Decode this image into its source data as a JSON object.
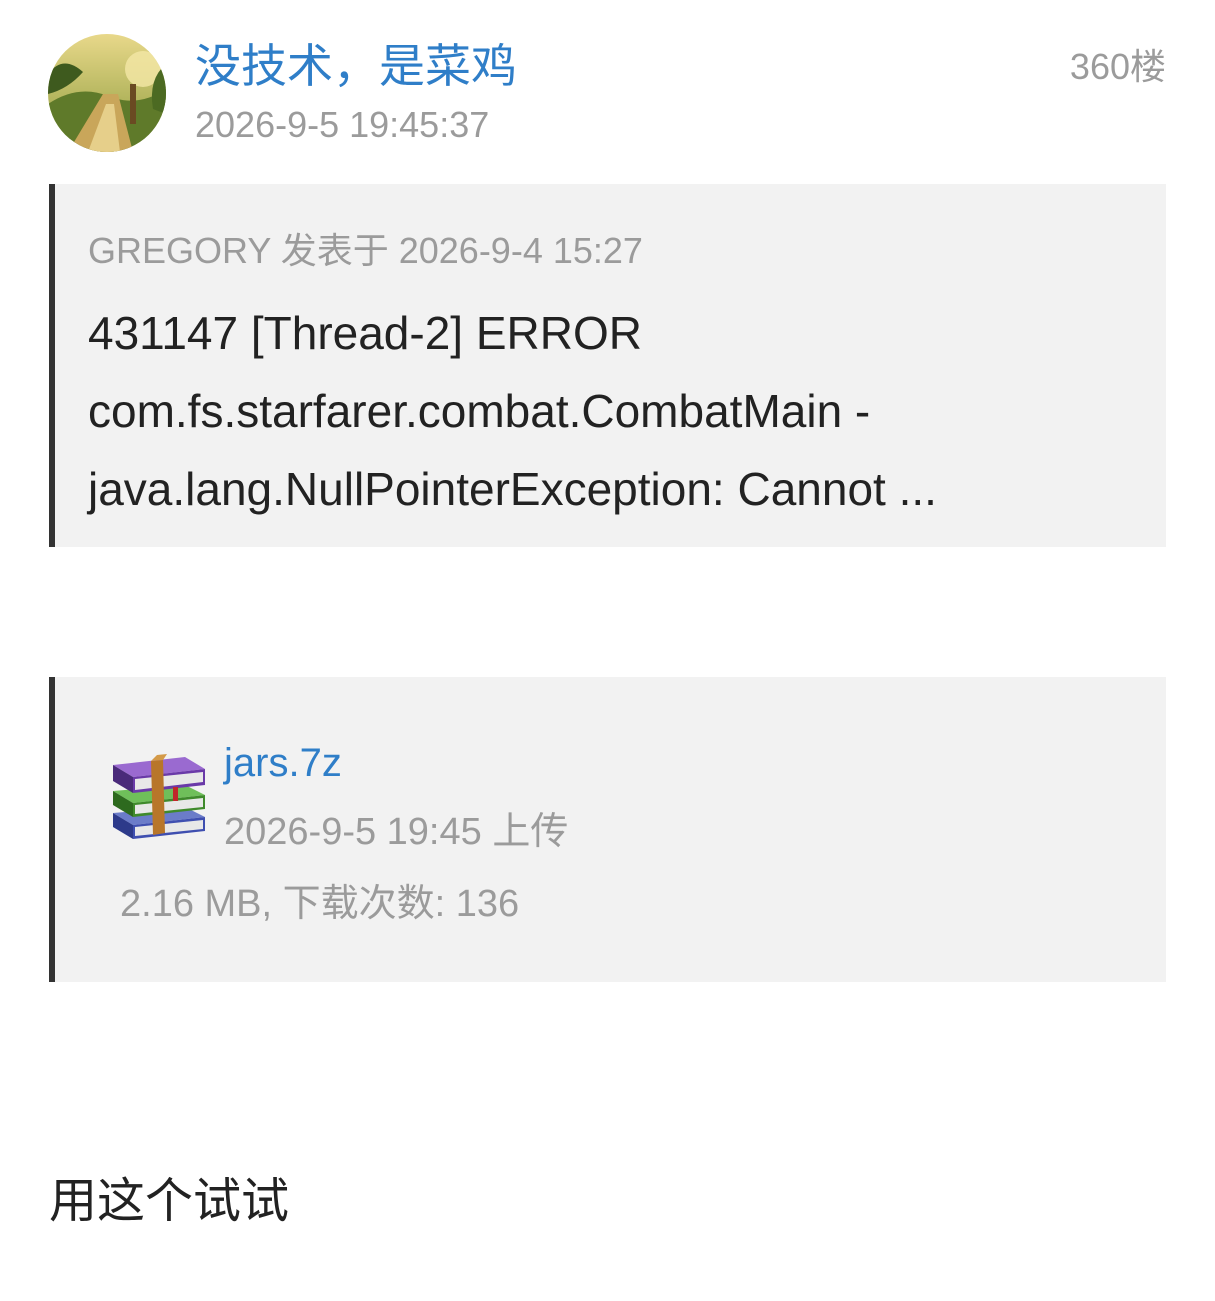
{
  "post": {
    "avatar_icon": "user-avatar-image",
    "username": "没技术，是菜鸡",
    "timestamp": "2026-9-5 19:45:37",
    "floor": "360楼"
  },
  "quote": {
    "meta": "GREGORY 发表于 2026-9-4 15:27",
    "lines": [
      "431147 [Thread-2] ERROR",
      "com.fs.starfarer.combat.CombatMain  -",
      "java.lang.NullPointerException: Cannot ..."
    ]
  },
  "attachment": {
    "icon": "archive-icon",
    "file_name": "jars.7z",
    "upload_time": "2026-9-5 19:45 上传",
    "info": "2.16 MB, 下载次数: 136"
  },
  "message": "用这个试试",
  "colors": {
    "link": "#2f7ec8",
    "muted_text": "#9b9b9b",
    "body_text": "#222222",
    "quote_background": "#f2f2f2",
    "quote_border": "#333333"
  }
}
